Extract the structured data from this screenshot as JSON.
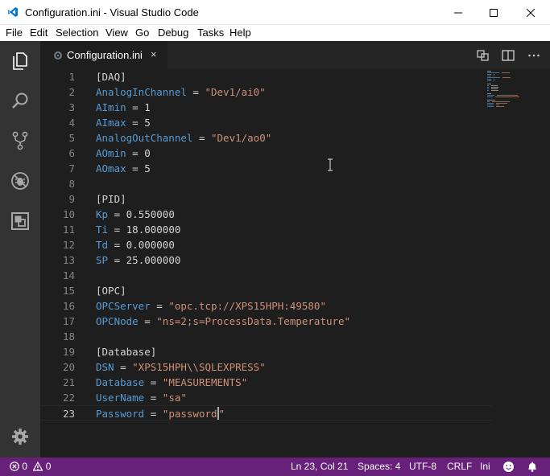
{
  "window": {
    "title": "Configuration.ini - Visual Studio Code"
  },
  "menu": [
    "File",
    "Edit",
    "Selection",
    "View",
    "Go",
    "Debug",
    "Tasks",
    "Help"
  ],
  "tab": {
    "label": "Configuration.ini",
    "close": "×"
  },
  "lines": [
    {
      "n": "1",
      "section": "[DAQ]"
    },
    {
      "n": "2",
      "key": "AnalogInChannel",
      "eq": " = ",
      "val": "\"Dev1/ai0\"",
      "str": true
    },
    {
      "n": "3",
      "key": "AImin",
      "eq": " = ",
      "val": "1"
    },
    {
      "n": "4",
      "key": "AImax",
      "eq": " = ",
      "val": "5"
    },
    {
      "n": "5",
      "key": "AnalogOutChannel",
      "eq": " = ",
      "val": "\"Dev1/ao0\"",
      "str": true
    },
    {
      "n": "6",
      "key": "AOmin",
      "eq": " = ",
      "val": "0"
    },
    {
      "n": "7",
      "key": "AOmax",
      "eq": " = ",
      "val": "5"
    },
    {
      "n": "8"
    },
    {
      "n": "9",
      "section": "[PID]"
    },
    {
      "n": "10",
      "key": "Kp",
      "eq": " = ",
      "val": "0.550000"
    },
    {
      "n": "11",
      "key": "Ti",
      "eq": " = ",
      "val": "18.000000"
    },
    {
      "n": "12",
      "key": "Td",
      "eq": " = ",
      "val": "0.000000"
    },
    {
      "n": "13",
      "key": "SP",
      "eq": " = ",
      "val": "25.000000"
    },
    {
      "n": "14"
    },
    {
      "n": "15",
      "section": "[OPC]"
    },
    {
      "n": "16",
      "key": "OPCServer",
      "eq": " = ",
      "val": "\"opc.tcp://XPS15HPH:49580\"",
      "str": true
    },
    {
      "n": "17",
      "key": "OPCNode",
      "eq": " = ",
      "val": "\"ns=2;s=ProcessData.Temperature\"",
      "str": true
    },
    {
      "n": "18"
    },
    {
      "n": "19",
      "section": "[Database]"
    },
    {
      "n": "20",
      "key": "DSN",
      "eq": " = ",
      "val": "\"XPS15HPH\\\\SQLEXPRESS\"",
      "str": true
    },
    {
      "n": "21",
      "key": "Database",
      "eq": " = ",
      "val": "\"MEASUREMENTS\"",
      "str": true
    },
    {
      "n": "22",
      "key": "UserName",
      "eq": " = ",
      "val": "\"sa\"",
      "str": true
    },
    {
      "n": "23",
      "key": "Password",
      "eq": " = ",
      "val": "\"password\"",
      "str": true,
      "current": true
    }
  ],
  "status": {
    "errors": "0",
    "warnings": "0",
    "position": "Ln 23, Col 21",
    "spaces": "Spaces: 4",
    "encoding": "UTF-8",
    "eol": "CRLF",
    "language": "Ini"
  },
  "colors": {
    "status_bar": "#68217a",
    "keyword": "#569cd6",
    "string": "#ce9178",
    "section": "#d4d4d4",
    "activity_bar": "#333333"
  },
  "icons": {
    "activity": [
      "files-icon",
      "search-icon",
      "source-control-icon",
      "debug-icon",
      "extensions-icon",
      "settings-gear-icon"
    ],
    "editor_actions": [
      "open-changes-icon",
      "split-editor-icon",
      "more-actions-icon"
    ]
  }
}
